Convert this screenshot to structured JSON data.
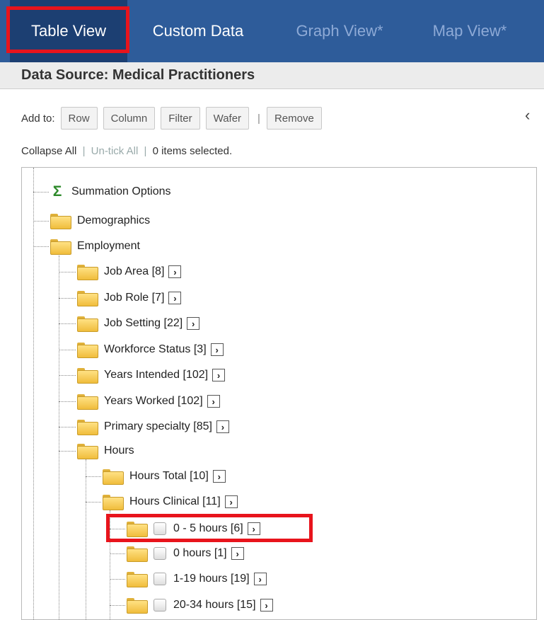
{
  "tabs": [
    {
      "label": "Table View",
      "state": "active"
    },
    {
      "label": "Custom Data",
      "state": "normal"
    },
    {
      "label": "Graph View*",
      "state": "disabled"
    },
    {
      "label": "Map View*",
      "state": "disabled"
    }
  ],
  "data_source": "Data Source: Medical Practitioners",
  "toolbar": {
    "prefix": "Add to:",
    "row": "Row",
    "column": "Column",
    "filter": "Filter",
    "wafer": "Wafer",
    "separator": "|",
    "remove": "Remove"
  },
  "status": {
    "collapse_all": "Collapse All",
    "untick_all": "Un-tick All",
    "selected": "0 items selected.",
    "pipe": "|"
  },
  "tree": {
    "summation": "Summation Options",
    "demographics": "Demographics",
    "employment": "Employment",
    "job_area": "Job Area [8]",
    "job_role": "Job Role [7]",
    "job_setting": "Job Setting [22]",
    "workforce_status": "Workforce Status [3]",
    "years_intended": "Years Intended [102]",
    "years_worked": "Years Worked [102]",
    "primary_specialty": "Primary specialty [85]",
    "hours": "Hours",
    "hours_total": "Hours Total [10]",
    "hours_clinical": "Hours Clinical [11]",
    "h_0_5": "0 - 5 hours [6]",
    "h_0": "0 hours [1]",
    "h_1_19": "1-19 hours [19]",
    "h_20_34": "20-34 hours [15]"
  },
  "icons": {
    "expand_glyph": "›",
    "collapse_panel_glyph": "‹",
    "sigma_glyph": "Σ"
  },
  "colors": {
    "tab_bar": "#2e5c9a",
    "tab_active": "#1c3f72",
    "highlight": "#e8141c"
  }
}
